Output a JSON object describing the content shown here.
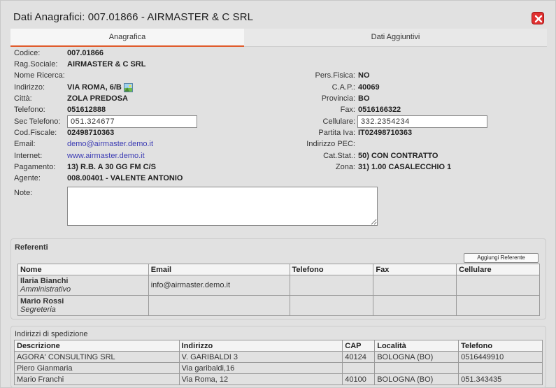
{
  "window": {
    "title": "Dati Anagrafici:  007.01866 - AIRMASTER & C SRL"
  },
  "tabs": [
    {
      "label": "Anagrafica"
    },
    {
      "label": "Dati Aggiuntivi"
    }
  ],
  "fields": {
    "codice": {
      "label": "Codice:",
      "value": "007.01866"
    },
    "rag_sociale": {
      "label": "Rag.Sociale:",
      "value": "AIRMASTER & C SRL"
    },
    "nome_ricerca": {
      "label": "Nome Ricerca:",
      "value": ""
    },
    "indirizzo": {
      "label": "Indirizzo:",
      "value": "VIA ROMA, 6/B"
    },
    "citta": {
      "label": "Città:",
      "value": "ZOLA PREDOSA"
    },
    "telefono": {
      "label": "Telefono:",
      "value": "051612888"
    },
    "sec_telefono": {
      "label": "Sec Telefono:",
      "value": "051.324677"
    },
    "cod_fiscale": {
      "label": "Cod.Fiscale:",
      "value": "02498710363"
    },
    "email": {
      "label": "Email:",
      "value": "demo@airmaster.demo.it"
    },
    "internet": {
      "label": "Internet:",
      "value": "www.airmaster.demo.it"
    },
    "pagamento": {
      "label": "Pagamento:",
      "value": "13) R.B. A 30 GG FM C/S"
    },
    "agente": {
      "label": "Agente:",
      "value": "008.00401 - VALENTE ANTONIO"
    },
    "note": {
      "label": "Note:",
      "value": ""
    },
    "pers_fisica": {
      "label": "Pers.Fisica:",
      "value": "NO"
    },
    "cap": {
      "label": "C.A.P.:",
      "value": "40069"
    },
    "provincia": {
      "label": "Provincia:",
      "value": "BO"
    },
    "fax": {
      "label": "Fax:",
      "value": "0516166322"
    },
    "cellulare": {
      "label": "Cellulare:",
      "value": "332.2354234"
    },
    "partita_iva": {
      "label": "Partita Iva:",
      "value": "IT02498710363"
    },
    "indirizzo_pec": {
      "label": "Indirizzo PEC:",
      "value": ""
    },
    "cat_stat": {
      "label": "Cat.Stat.:",
      "value": "50) CON CONTRATTO"
    },
    "zona": {
      "label": "Zona:",
      "value": "31) 1.00 CASALECCHIO 1"
    }
  },
  "referenti": {
    "title": "Referenti",
    "add_button": "Aggiungi Referente",
    "columns": [
      "Nome",
      "Email",
      "Telefono",
      "Fax",
      "Cellulare"
    ],
    "rows": [
      {
        "name": "Ilaria Bianchi",
        "role": "Amministrativo",
        "email": "info@airmaster.demo.it",
        "telefono": "",
        "fax": "",
        "cellulare": ""
      },
      {
        "name": "Mario Rossi",
        "role": "Segreteria",
        "email": "",
        "telefono": "",
        "fax": "",
        "cellulare": ""
      }
    ]
  },
  "spedizione": {
    "title": "Indirizzi di spedizione",
    "columns": [
      "Descrizione",
      "Indirizzo",
      "CAP",
      "Località",
      "Telefono"
    ],
    "rows": [
      {
        "descrizione": "AGORA' CONSULTING SRL",
        "indirizzo": "V. GARIBALDI 3",
        "cap": "40124",
        "localita": "BOLOGNA (BO)",
        "telefono": "0516449910"
      },
      {
        "descrizione": "Piero Gianmaria",
        "indirizzo": "Via garibaldi,16",
        "cap": "",
        "localita": "",
        "telefono": ""
      },
      {
        "descrizione": "Mario Franchi",
        "indirizzo": "Via Roma, 12",
        "cap": "40100",
        "localita": "BOLOGNA (BO)",
        "telefono": "051.343435"
      }
    ]
  },
  "colors": {
    "accent": "#e05a2a",
    "link": "#3c3cb4",
    "close": "#e03030"
  },
  "icons": {
    "close": "close-icon",
    "map": "map-icon"
  }
}
